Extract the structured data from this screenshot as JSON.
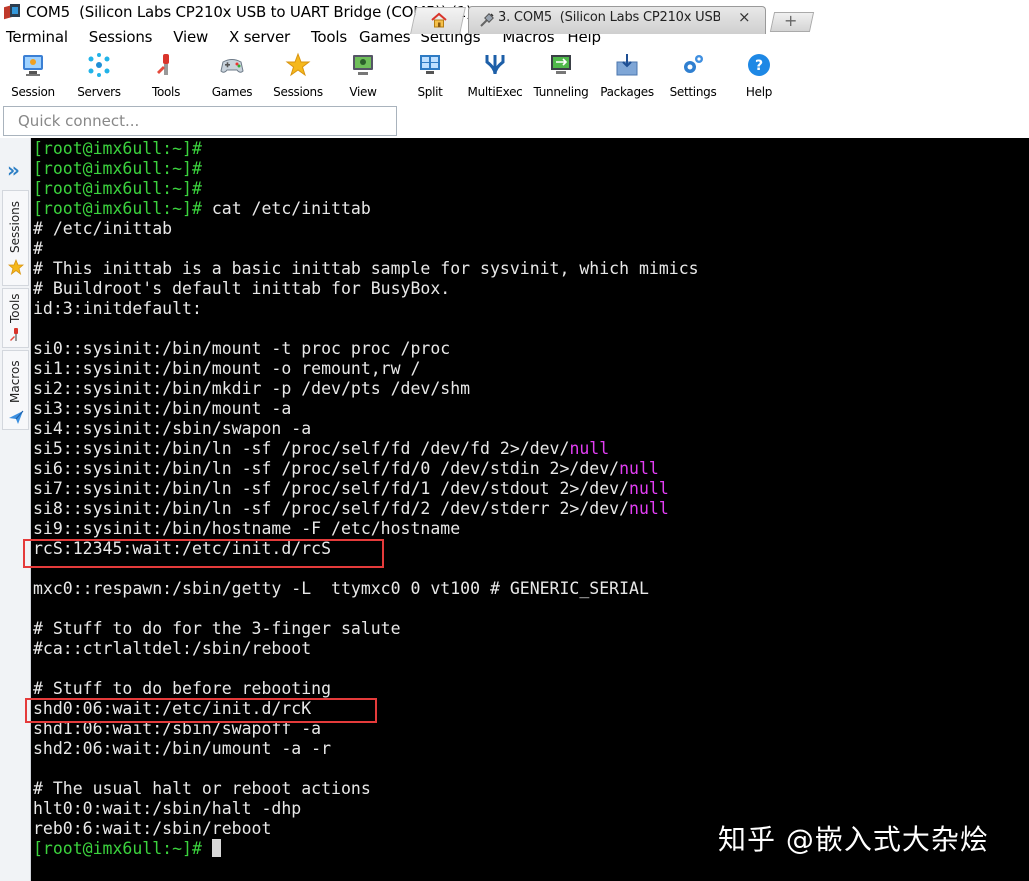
{
  "window": {
    "title": "COM5  (Silicon Labs CP210x USB to UART Bridge (COM5)) (1)"
  },
  "menu": {
    "items": [
      "Terminal",
      "Sessions",
      "View",
      "X server",
      "Tools",
      "Games",
      "Settings",
      "Macros",
      "Help"
    ]
  },
  "toolbar": {
    "items": [
      {
        "label": "Session",
        "icon": "session-icon"
      },
      {
        "label": "Servers",
        "icon": "servers-icon"
      },
      {
        "label": "Tools",
        "icon": "tools-icon"
      },
      {
        "label": "Games",
        "icon": "games-icon"
      },
      {
        "label": "Sessions",
        "icon": "sessions-star-icon"
      },
      {
        "label": "View",
        "icon": "view-icon"
      },
      {
        "label": "Split",
        "icon": "split-icon"
      },
      {
        "label": "MultiExec",
        "icon": "multiexec-icon"
      },
      {
        "label": "Tunneling",
        "icon": "tunneling-icon"
      },
      {
        "label": "Packages",
        "icon": "packages-icon"
      },
      {
        "label": "Settings",
        "icon": "settings-gears-icon"
      },
      {
        "label": "Help",
        "icon": "help-icon"
      }
    ]
  },
  "quick_connect": {
    "placeholder": "Quick connect..."
  },
  "tabs": {
    "session_label": "3. COM5  (Silicon Labs CP210x USB",
    "close_glyph": "×",
    "new_tab_glyph": "+"
  },
  "side_panel": {
    "tabs": [
      "Sessions",
      "Tools",
      "Macros"
    ]
  },
  "terminal": {
    "prompt": "[root@imx6ull:~]#",
    "lines": [
      {
        "type": "prompt",
        "cmd": ""
      },
      {
        "type": "prompt",
        "cmd": ""
      },
      {
        "type": "prompt",
        "cmd": ""
      },
      {
        "type": "prompt",
        "cmd": " cat /etc/inittab"
      },
      {
        "type": "text",
        "text": "# /etc/inittab"
      },
      {
        "type": "text",
        "text": "#"
      },
      {
        "type": "text",
        "text": "# This inittab is a basic inittab sample for sysvinit, which mimics"
      },
      {
        "type": "text",
        "text": "# Buildroot's default inittab for BusyBox."
      },
      {
        "type": "text",
        "text": "id:3:initdefault:"
      },
      {
        "type": "text",
        "text": ""
      },
      {
        "type": "text",
        "text": "si0::sysinit:/bin/mount -t proc proc /proc"
      },
      {
        "type": "text",
        "text": "si1::sysinit:/bin/mount -o remount,rw /"
      },
      {
        "type": "text",
        "text": "si2::sysinit:/bin/mkdir -p /dev/pts /dev/shm"
      },
      {
        "type": "text",
        "text": "si3::sysinit:/bin/mount -a"
      },
      {
        "type": "text",
        "text": "si4::sysinit:/sbin/swapon -a"
      },
      {
        "type": "null",
        "text": "si5::sysinit:/bin/ln -sf /proc/self/fd /dev/fd 2>/dev/",
        "kw": "null"
      },
      {
        "type": "null",
        "text": "si6::sysinit:/bin/ln -sf /proc/self/fd/0 /dev/stdin 2>/dev/",
        "kw": "null"
      },
      {
        "type": "null",
        "text": "si7::sysinit:/bin/ln -sf /proc/self/fd/1 /dev/stdout 2>/dev/",
        "kw": "null"
      },
      {
        "type": "null",
        "text": "si8::sysinit:/bin/ln -sf /proc/self/fd/2 /dev/stderr 2>/dev/",
        "kw": "null"
      },
      {
        "type": "text",
        "text": "si9::sysinit:/bin/hostname -F /etc/hostname"
      },
      {
        "type": "text",
        "text": "rcS:12345:wait:/etc/init.d/rcS",
        "highlight": true
      },
      {
        "type": "text",
        "text": ""
      },
      {
        "type": "text",
        "text": "mxc0::respawn:/sbin/getty -L  ttymxc0 0 vt100 # GENERIC_SERIAL"
      },
      {
        "type": "text",
        "text": ""
      },
      {
        "type": "text",
        "text": "# Stuff to do for the 3-finger salute"
      },
      {
        "type": "text",
        "text": "#ca::ctrlaltdel:/sbin/reboot"
      },
      {
        "type": "text",
        "text": ""
      },
      {
        "type": "text",
        "text": "# Stuff to do before rebooting"
      },
      {
        "type": "text",
        "text": "shd0:06:wait:/etc/init.d/rcK",
        "highlight": true
      },
      {
        "type": "text",
        "text": "shd1:06:wait:/sbin/swapoff -a"
      },
      {
        "type": "text",
        "text": "shd2:06:wait:/bin/umount -a -r"
      },
      {
        "type": "text",
        "text": ""
      },
      {
        "type": "text",
        "text": "# The usual halt or reboot actions"
      },
      {
        "type": "text",
        "text": "hlt0:0:wait:/sbin/halt -dhp"
      },
      {
        "type": "text",
        "text": "reb0:6:wait:/sbin/reboot"
      },
      {
        "type": "cursor",
        "cmd": " "
      }
    ]
  },
  "watermark": "知乎 @嵌入式大杂烩",
  "colors": {
    "prompt": "#3bd23d",
    "null_keyword": "#e23ef3",
    "highlight_box": "#e53b3b",
    "terminal_bg": "#000000"
  }
}
